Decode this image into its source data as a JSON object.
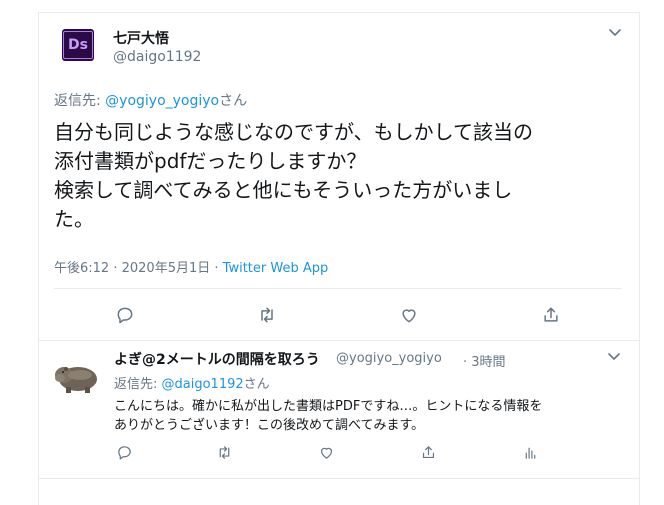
{
  "tweet": {
    "avatar_text": "Ds",
    "author_name": "七戸大悟",
    "author_handle": "@daigo1192",
    "reply_to_prefix": "返信先: ",
    "reply_to_handle": "@yogiyo_yogiyo",
    "reply_to_suffix": "さん",
    "text": "自分も同じような感じなのですが、もしかして該当の\n添付書類がpdfだったりしますか？\n検索して調べてみると他にもそういった方がいまし\nた。",
    "time": "午後6:12",
    "separator": " · ",
    "date": "2020年5月1日",
    "source": "Twitter Web App"
  },
  "reply": {
    "author_name": "よぎ@2メートルの間隔を取ろう",
    "author_handle": "@yogiyo_yogiyo",
    "time_prefix": " · ",
    "time": "3時間",
    "reply_to_prefix": "返信先: ",
    "reply_to_handle": "@daigo1192",
    "reply_to_suffix": "さん",
    "text": "こんにちは。確かに私が出した書類はPDFですね…。ヒントになる情報を\nありがとうございます！この後改めて調べてみます。"
  },
  "icons": {
    "chevron": "chevron-down-icon",
    "reply": "reply-icon",
    "retweet": "retweet-icon",
    "like": "like-icon",
    "share": "share-icon",
    "analytics": "analytics-icon"
  },
  "colors": {
    "link": "#1b95e0",
    "secondary_text": "#657786",
    "border": "#e6ecf0"
  }
}
